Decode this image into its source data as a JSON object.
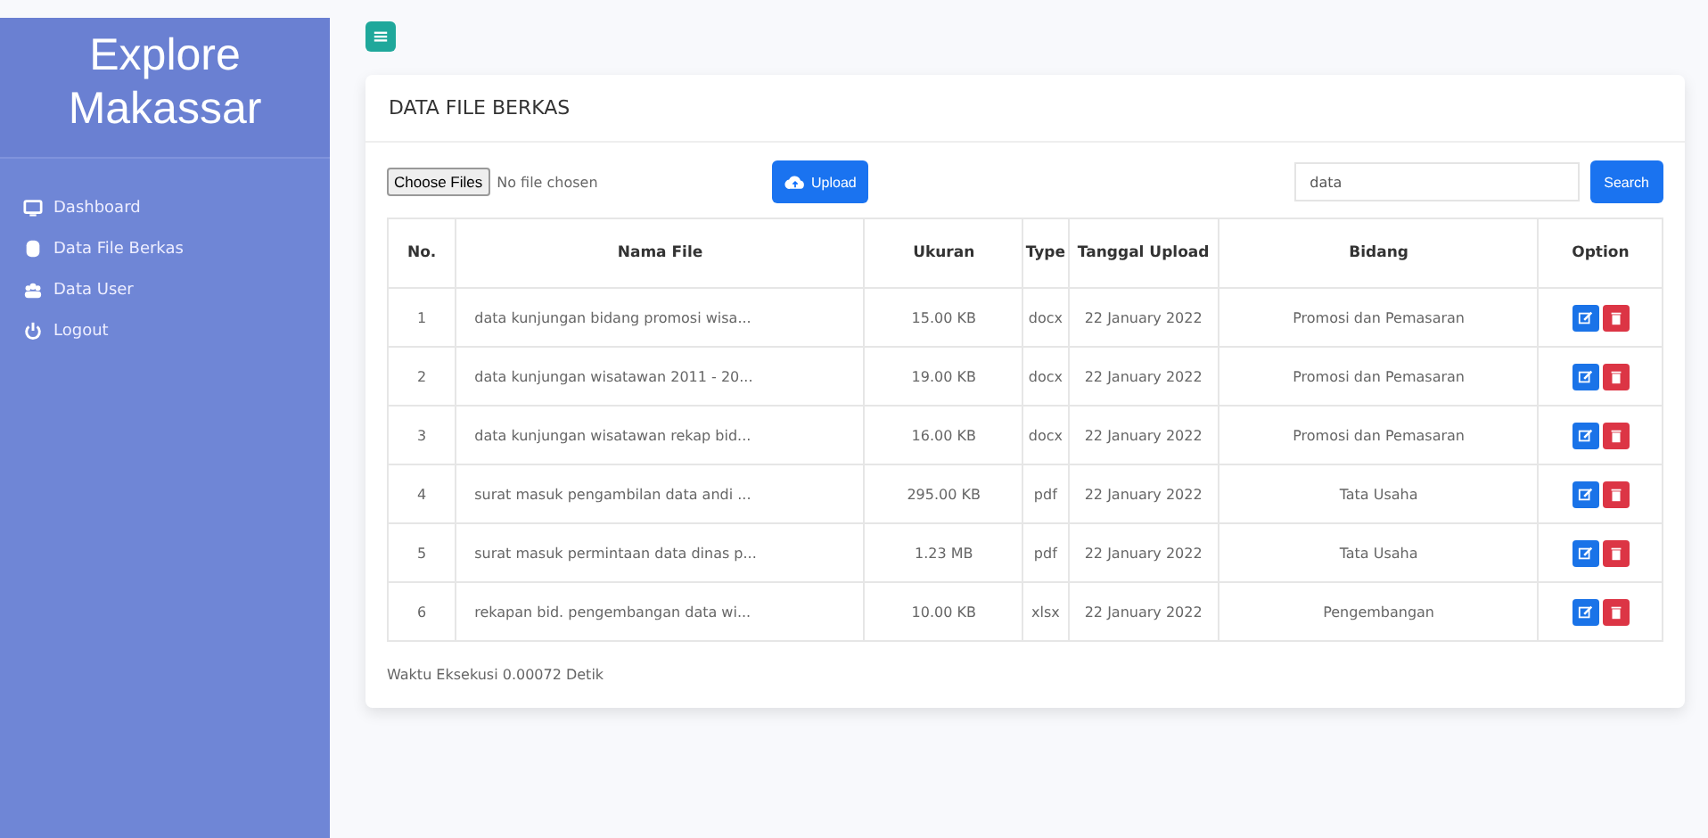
{
  "sidebar": {
    "brand": "Explore Makassar",
    "items": [
      {
        "label": "Dashboard",
        "kind": "monitor"
      },
      {
        "label": "Data File Berkas",
        "kind": "database"
      },
      {
        "label": "Data User",
        "kind": "users"
      },
      {
        "label": "Logout",
        "kind": "power"
      }
    ]
  },
  "card": {
    "title": "DATA FILE BERKAS",
    "file_input": {
      "button": "Choose Files",
      "status": "No file chosen"
    },
    "upload_button": "Upload",
    "search": {
      "value": "data",
      "button": "Search"
    },
    "table": {
      "columns": [
        "No.",
        "Nama File",
        "Ukuran",
        "Type",
        "Tanggal Upload",
        "Bidang",
        "Option"
      ],
      "rows": [
        [
          "1",
          "data kunjungan bidang promosi wisa...",
          "15.00 KB",
          "docx",
          "22 January 2022",
          "Promosi dan Pemasaran"
        ],
        [
          "2",
          "data kunjungan wisatawan 2011 - 20...",
          "19.00 KB",
          "docx",
          "22 January 2022",
          "Promosi dan Pemasaran"
        ],
        [
          "3",
          "data kunjungan wisatawan rekap bid...",
          "16.00 KB",
          "docx",
          "22 January 2022",
          "Promosi dan Pemasaran"
        ],
        [
          "4",
          "surat masuk pengambilan data andi ...",
          "295.00 KB",
          "pdf",
          "22 January 2022",
          "Tata Usaha"
        ],
        [
          "5",
          "surat masuk permintaan data dinas p...",
          "1.23 MB",
          "pdf",
          "22 January 2022",
          "Tata Usaha"
        ],
        [
          "6",
          "rekapan bid. pengembangan data wi...",
          "10.00 KB",
          "xlsx",
          "22 January 2022",
          "Pengembangan"
        ]
      ]
    },
    "footer": "Waktu Eksekusi 0.00072 Detik"
  }
}
